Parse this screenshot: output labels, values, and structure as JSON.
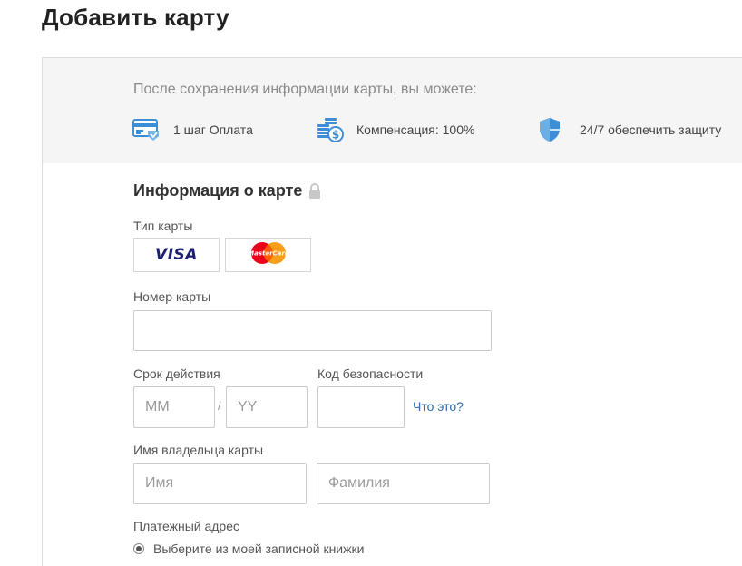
{
  "page": {
    "title": "Добавить карту"
  },
  "benefits": {
    "heading": "После сохранения информации карты, вы можете:",
    "items": [
      {
        "icon": "card-payment-icon",
        "text": "1 шаг Оплата"
      },
      {
        "icon": "coins-stack-icon",
        "text": "Компенсация: 100%"
      },
      {
        "icon": "shield-icon",
        "text": "24/7 обеспечить защиту"
      }
    ]
  },
  "card_info": {
    "title": "Информация о карте",
    "lock_icon": "lock-icon",
    "card_type_label": "Тип карты",
    "card_types": {
      "visa": "VISA",
      "mastercard": "MasterCard"
    },
    "card_number_label": "Номер карты",
    "card_number_value": "",
    "expiry_label": "Срок действия",
    "expiry_month_placeholder": "MM",
    "expiry_year_placeholder": "YY",
    "expiry_separator": "/",
    "security_code_label": "Код безопасности",
    "security_code_value": "",
    "security_help_link": "Что это?",
    "holder_label": "Имя владельца карты",
    "first_name_placeholder": "Имя",
    "last_name_placeholder": "Фамилия",
    "billing_address_label": "Платежный адрес",
    "billing_option_label": "Выберите из моей записной книжки"
  },
  "colors": {
    "link": "#2f6db0",
    "icon_blue": "#3c8fd6",
    "panel_gray": "#f5f5f5",
    "visa_blue": "#1a1f71",
    "mastercard_red": "#eb001b",
    "mastercard_orange": "#f79e1b"
  }
}
